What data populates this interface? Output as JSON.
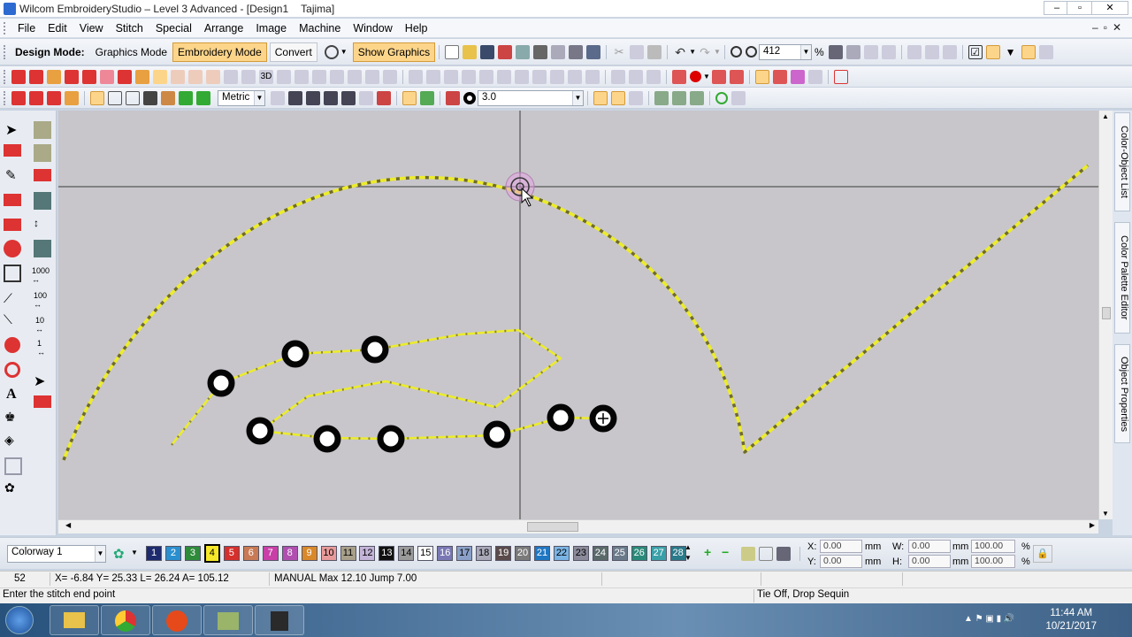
{
  "window": {
    "title": "Wilcom EmbroideryStudio – Level 3 Advanced - [Design1",
    "machine": "Tajima]",
    "controls": [
      "–",
      "▫",
      "✕"
    ]
  },
  "menu": [
    "File",
    "Edit",
    "View",
    "Stitch",
    "Special",
    "Arrange",
    "Image",
    "Machine",
    "Window",
    "Help"
  ],
  "toolbar": {
    "design_mode_label": "Design Mode:",
    "graphics_mode": "Graphics Mode",
    "embroidery_mode": "Embroidery Mode",
    "convert": "Convert",
    "show_graphics": "Show Graphics",
    "zoom_value": "412",
    "zoom_unit": "%",
    "units": "Metric",
    "sequin_size": "3.0"
  },
  "lefttools": {
    "stitch_lengths": [
      "1000",
      "100",
      "10",
      "1"
    ]
  },
  "right_tabs": [
    "Color-Object List",
    "Color Palette Editor",
    "Object Properties"
  ],
  "colorway": {
    "label": "Colorway 1",
    "swatches": [
      {
        "n": "1",
        "color": "#1d2b6e",
        "text": "#ffffff"
      },
      {
        "n": "2",
        "color": "#2a8fcf",
        "text": "#ffffff"
      },
      {
        "n": "3",
        "color": "#2e8b3a",
        "text": "#ffffff"
      },
      {
        "n": "4",
        "color": "#f5e82a",
        "text": "#000000"
      },
      {
        "n": "5",
        "color": "#d6302c",
        "text": "#ffffff"
      },
      {
        "n": "6",
        "color": "#c97a54",
        "text": "#ffffff"
      },
      {
        "n": "7",
        "color": "#c93fa8",
        "text": "#ffffff"
      },
      {
        "n": "8",
        "color": "#b04fb0",
        "text": "#ffffff"
      },
      {
        "n": "9",
        "color": "#d9882a",
        "text": "#ffffff"
      },
      {
        "n": "10",
        "color": "#e89a9a",
        "text": "#000000"
      },
      {
        "n": "11",
        "color": "#a8a08a",
        "text": "#000000"
      },
      {
        "n": "12",
        "color": "#c4b4d8",
        "text": "#000000"
      },
      {
        "n": "13",
        "color": "#111111",
        "text": "#ffffff"
      },
      {
        "n": "14",
        "color": "#9a9a9a",
        "text": "#000000"
      },
      {
        "n": "15",
        "color": "#ffffff",
        "text": "#000000"
      },
      {
        "n": "16",
        "color": "#7a78b4",
        "text": "#ffffff"
      },
      {
        "n": "17",
        "color": "#8aa0c8",
        "text": "#000000"
      },
      {
        "n": "18",
        "color": "#a8a8b8",
        "text": "#000000"
      },
      {
        "n": "19",
        "color": "#5a4a4a",
        "text": "#ffffff"
      },
      {
        "n": "20",
        "color": "#7a7a7a",
        "text": "#ffffff"
      },
      {
        "n": "21",
        "color": "#1f76c2",
        "text": "#ffffff"
      },
      {
        "n": "22",
        "color": "#7ab4e4",
        "text": "#000000"
      },
      {
        "n": "23",
        "color": "#8a8a9a",
        "text": "#000000"
      },
      {
        "n": "24",
        "color": "#5a6a6a",
        "text": "#ffffff"
      },
      {
        "n": "25",
        "color": "#6a7a8a",
        "text": "#ffffff"
      },
      {
        "n": "26",
        "color": "#2a8a7a",
        "text": "#ffffff"
      },
      {
        "n": "27",
        "color": "#3aa0a8",
        "text": "#ffffff"
      },
      {
        "n": "28",
        "color": "#2a7a8a",
        "text": "#ffffff"
      }
    ],
    "selected": "4"
  },
  "transform": {
    "x_label": "X:",
    "x_value": "0.00",
    "y_label": "Y:",
    "y_value": "0.00",
    "w_label": "W:",
    "w_value": "0.00",
    "h_label": "H:",
    "h_value": "0.00",
    "unit": "mm",
    "scale_w": "100.00",
    "scale_h": "100.00",
    "pct": "%"
  },
  "status": {
    "stitch_count": "52",
    "coords": "X=  -6.84 Y=  25.33 L=  26.24 A= 105.12",
    "settings": "MANUAL Max 12.10 Jump 7.00",
    "prompt": "Enter the stitch end point",
    "tool": "Tie Off, Drop Sequin"
  },
  "taskbar": {
    "time": "11:44 AM",
    "date": "10/21/2017"
  },
  "colors": {
    "canvas": "#c8c6cb",
    "thread": "#ecec2c",
    "thread_shadow": "#6e6a2e",
    "active_button": "#fdd58a"
  }
}
